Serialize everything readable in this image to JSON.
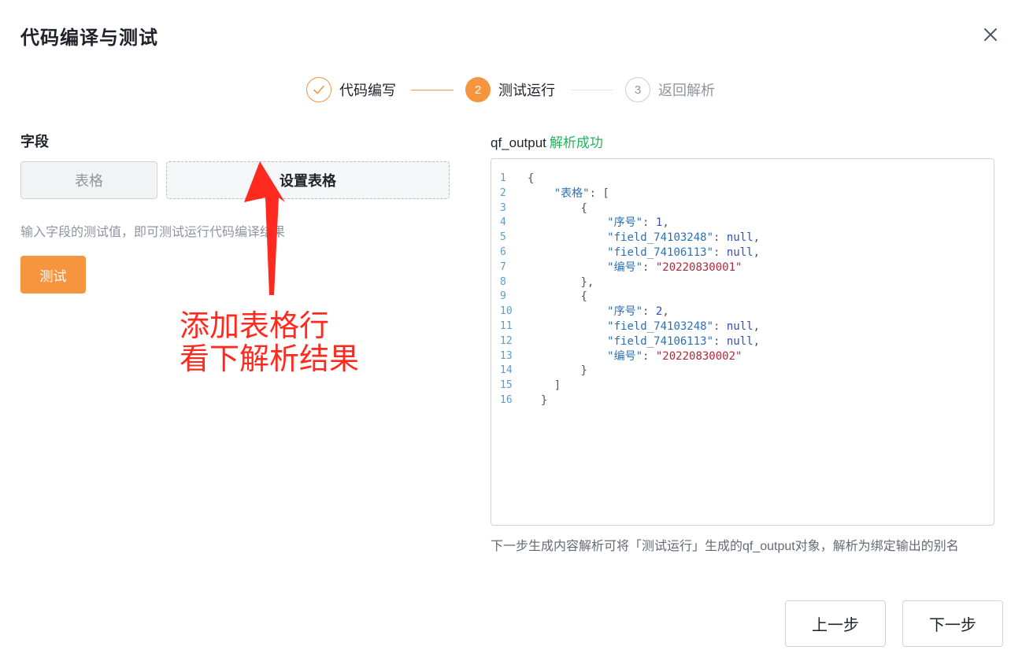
{
  "dialog": {
    "title": "代码编译与测试",
    "close_icon": "close-icon"
  },
  "steps": [
    {
      "number": "1",
      "label": "代码编写",
      "status": "finish",
      "icon": "check-icon"
    },
    {
      "number": "2",
      "label": "测试运行",
      "status": "process"
    },
    {
      "number": "3",
      "label": "返回解析",
      "status": "wait"
    }
  ],
  "left": {
    "section_label": "字段",
    "field_tag": "表格",
    "setup_button": "设置表格",
    "hint": "输入字段的测试值，即可测试运行代码编译结果",
    "test_button": "测试"
  },
  "annotation": {
    "line1": "添加表格行",
    "line2": "看下解析结果",
    "color": "#ff2a1f"
  },
  "right": {
    "output_name": "qf_output",
    "status_text": "解析成功",
    "status_color": "#24b35d",
    "footnote": "下一步生成内容解析可将「测试运行」生成的qf_output对象，解析为绑定输出的别名"
  },
  "code": [
    {
      "n": "1",
      "indent": 0,
      "tokens": [
        [
          "p",
          "{"
        ]
      ]
    },
    {
      "n": "2",
      "indent": 4,
      "tokens": [
        [
          "k",
          "\"表格\""
        ],
        [
          "p",
          ": ["
        ]
      ]
    },
    {
      "n": "3",
      "indent": 8,
      "tokens": [
        [
          "p",
          "{"
        ]
      ]
    },
    {
      "n": "4",
      "indent": 12,
      "tokens": [
        [
          "k",
          "\"序号\""
        ],
        [
          "p",
          ": "
        ],
        [
          "n",
          "1"
        ],
        [
          "p",
          ","
        ]
      ]
    },
    {
      "n": "5",
      "indent": 12,
      "tokens": [
        [
          "k",
          "\"field_74103248\""
        ],
        [
          "p",
          ": "
        ],
        [
          "z",
          "null"
        ],
        [
          "p",
          ","
        ]
      ]
    },
    {
      "n": "6",
      "indent": 12,
      "tokens": [
        [
          "k",
          "\"field_74106113\""
        ],
        [
          "p",
          ": "
        ],
        [
          "z",
          "null"
        ],
        [
          "p",
          ","
        ]
      ]
    },
    {
      "n": "7",
      "indent": 12,
      "tokens": [
        [
          "k",
          "\"编号\""
        ],
        [
          "p",
          ": "
        ],
        [
          "s",
          "\"20220830001\""
        ]
      ]
    },
    {
      "n": "8",
      "indent": 8,
      "tokens": [
        [
          "p",
          "},"
        ]
      ]
    },
    {
      "n": "9",
      "indent": 8,
      "tokens": [
        [
          "p",
          "{"
        ]
      ]
    },
    {
      "n": "10",
      "indent": 12,
      "tokens": [
        [
          "k",
          "\"序号\""
        ],
        [
          "p",
          ": "
        ],
        [
          "n",
          "2"
        ],
        [
          "p",
          ","
        ]
      ]
    },
    {
      "n": "11",
      "indent": 12,
      "tokens": [
        [
          "k",
          "\"field_74103248\""
        ],
        [
          "p",
          ": "
        ],
        [
          "z",
          "null"
        ],
        [
          "p",
          ","
        ]
      ]
    },
    {
      "n": "12",
      "indent": 12,
      "tokens": [
        [
          "k",
          "\"field_74106113\""
        ],
        [
          "p",
          ": "
        ],
        [
          "z",
          "null"
        ],
        [
          "p",
          ","
        ]
      ]
    },
    {
      "n": "13",
      "indent": 12,
      "tokens": [
        [
          "k",
          "\"编号\""
        ],
        [
          "p",
          ": "
        ],
        [
          "s",
          "\"20220830002\""
        ]
      ]
    },
    {
      "n": "14",
      "indent": 8,
      "tokens": [
        [
          "p",
          "}"
        ]
      ]
    },
    {
      "n": "15",
      "indent": 4,
      "tokens": [
        [
          "p",
          "]"
        ]
      ]
    },
    {
      "n": "16",
      "indent": 2,
      "tokens": [
        [
          "p",
          "}"
        ]
      ]
    }
  ],
  "footer": {
    "prev_button": "上一步",
    "next_button": "下一步"
  },
  "colors": {
    "accent": "#f7943e",
    "success": "#24b35d",
    "muted": "#8f959e"
  }
}
